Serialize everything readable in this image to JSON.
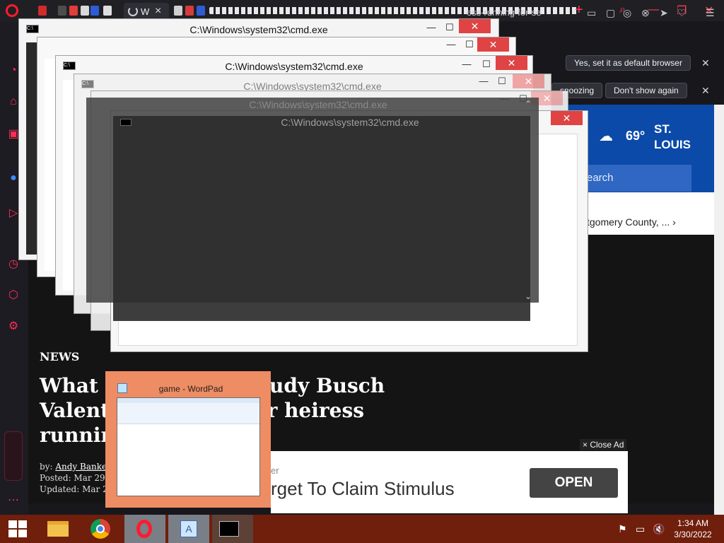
{
  "browser": {
    "active_tab_label": "W",
    "address_text": "ess-running-for-se",
    "notification": {
      "default_browser_button": "Yes, set it as default browser",
      "snoozing_button": "snoozing",
      "dont_show_button": "Don't show again"
    }
  },
  "website": {
    "weather": {
      "temp": "69°",
      "city_line1": "ST.",
      "city_line2": "LOUIS"
    },
    "search_placeholder": "earch",
    "headline_link": "tgomery County, ... ›",
    "section_label": "NEWS",
    "title_line1": "What t                     rudy Busch",
    "title_line2": "Valent                     er heiress",
    "title_line3": "runnin",
    "byline": {
      "by_prefix": "by:",
      "author": "Andy Banker",
      "posted": "Posted: Mar 29, 2",
      "updated": "Updated: Mar 29,"
    },
    "ad": {
      "close_ad": "× Close Ad",
      "small_text": "er",
      "main_text": "rget To Claim Stimulus",
      "open_button": "OPEN"
    }
  },
  "cmd_windows": [
    {
      "title": "C:\\Windows\\system32\\cmd.exe"
    },
    {
      "title": "C:\\Windows\\system32\\cmd.exe"
    },
    {
      "title": "C:\\Windows\\system32\\cmd.exe"
    },
    {
      "title": "C:\\Windows\\system32\\cmd.exe"
    },
    {
      "title": "C:\\Windows\\system32\\cmd.exe"
    }
  ],
  "wordpad_preview": {
    "title": "game - WordPad"
  },
  "taskbar": {
    "time": "1:34 AM",
    "date": "3/30/2022"
  }
}
